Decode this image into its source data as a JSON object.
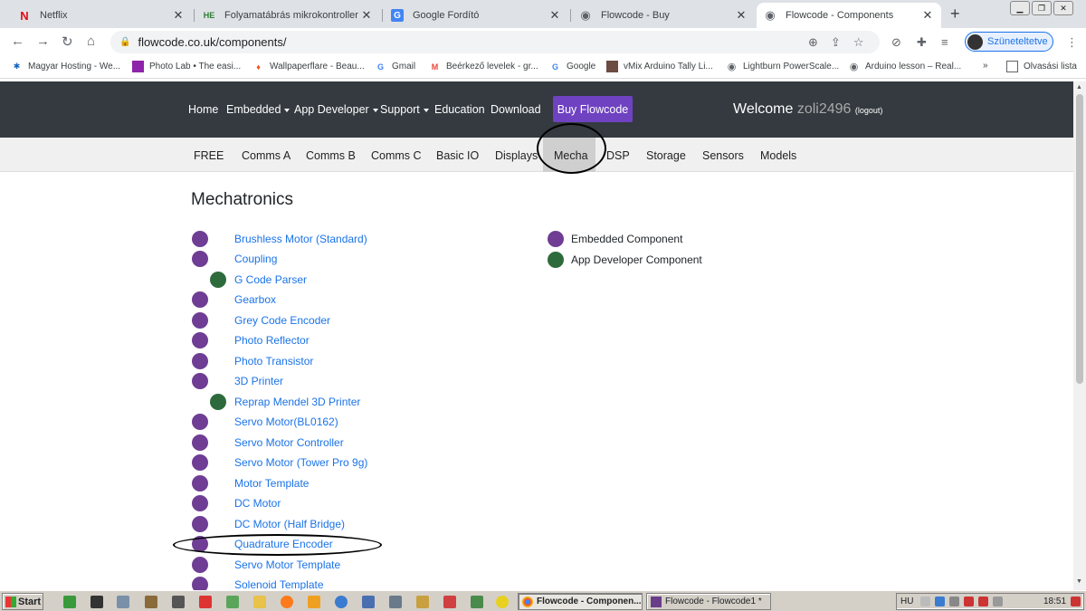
{
  "tabs": [
    {
      "title": "Netflix",
      "icon": "netflix-icon",
      "color": "#e50914",
      "glyph": "N"
    },
    {
      "title": "Folyamatábrás mikrokontroller prog",
      "icon": "he-icon",
      "color": "#2d7d32",
      "glyph": "HE"
    },
    {
      "title": "Google Fordító",
      "icon": "google-translate-icon",
      "color": "#4285f4",
      "glyph": "G"
    },
    {
      "title": "Flowcode - Buy",
      "icon": "globe-icon",
      "color": "#5f6368",
      "glyph": "◉"
    },
    {
      "title": "Flowcode - Components",
      "icon": "globe-icon",
      "color": "#5f6368",
      "glyph": "◉"
    }
  ],
  "address": "flowcode.co.uk/components/",
  "profile_label": "Szüneteltetve",
  "bookmarks": [
    {
      "label": "Magyar Hosting - We...",
      "color": "#1565c0"
    },
    {
      "label": "Photo Lab • The easi...",
      "color": "#8e24aa"
    },
    {
      "label": "Wallpaperflare - Beau...",
      "color": "#f4511e"
    },
    {
      "label": "Gmail",
      "color": "#4285f4"
    },
    {
      "label": "Beérkező levelek - gr...",
      "color": "#ea4335"
    },
    {
      "label": "Google",
      "color": "#4285f4"
    },
    {
      "label": "vMix Arduino Tally Li...",
      "color": "#6d4c41"
    },
    {
      "label": "Lightburn PowerScale...",
      "color": "#5f6368"
    },
    {
      "label": "Arduino lesson – Real...",
      "color": "#5f6368"
    }
  ],
  "bookmarks_more": "»",
  "reading_list": "Olvasási lista",
  "nav": {
    "home": "Home",
    "embedded": "Embedded",
    "app_developer": "App Developer",
    "support": "Support",
    "education": "Education",
    "download": "Download",
    "buy": "Buy Flowcode",
    "welcome": "Welcome",
    "username": "zoli2496",
    "logout": "(logout)"
  },
  "subnav": [
    "FREE",
    "Comms A",
    "Comms B",
    "Comms C",
    "Basic IO",
    "Displays",
    "Mecha",
    "DSP",
    "Storage",
    "Sensors",
    "Models"
  ],
  "subnav_active": "Mecha",
  "page_title": "Mechatronics",
  "components": [
    {
      "name": "Brushless Motor (Standard)",
      "type": "embedded"
    },
    {
      "name": "Coupling",
      "type": "embedded"
    },
    {
      "name": "G Code Parser",
      "type": "app"
    },
    {
      "name": "Gearbox",
      "type": "embedded"
    },
    {
      "name": "Grey Code Encoder",
      "type": "embedded"
    },
    {
      "name": "Photo Reflector",
      "type": "embedded"
    },
    {
      "name": "Photo Transistor",
      "type": "embedded"
    },
    {
      "name": "3D Printer",
      "type": "embedded"
    },
    {
      "name": "Reprap Mendel 3D Printer",
      "type": "app"
    },
    {
      "name": "Servo Motor(BL0162)",
      "type": "embedded"
    },
    {
      "name": "Servo Motor Controller",
      "type": "embedded"
    },
    {
      "name": "Servo Motor (Tower Pro 9g)",
      "type": "embedded"
    },
    {
      "name": "Motor Template",
      "type": "embedded"
    },
    {
      "name": "DC Motor",
      "type": "embedded"
    },
    {
      "name": "DC Motor (Half Bridge)",
      "type": "embedded"
    },
    {
      "name": "Quadrature Encoder",
      "type": "embedded"
    },
    {
      "name": "Servo Motor Template",
      "type": "embedded"
    },
    {
      "name": "Solenoid Template",
      "type": "embedded"
    }
  ],
  "legend": {
    "embedded": "Embedded Component",
    "app": "App Developer Component"
  },
  "colors": {
    "embedded": "#6f3d94",
    "app": "#2e6b3c",
    "link": "#1a73e8",
    "buy_button": "#6f42c1"
  },
  "taskbar": {
    "start": "Start",
    "items": [
      {
        "label": "Flowcode - Componen...",
        "pressed": true
      },
      {
        "label": "Flowcode - Flowcode1 *",
        "pressed": false
      }
    ],
    "lang": "HU",
    "clock": "18:51"
  }
}
